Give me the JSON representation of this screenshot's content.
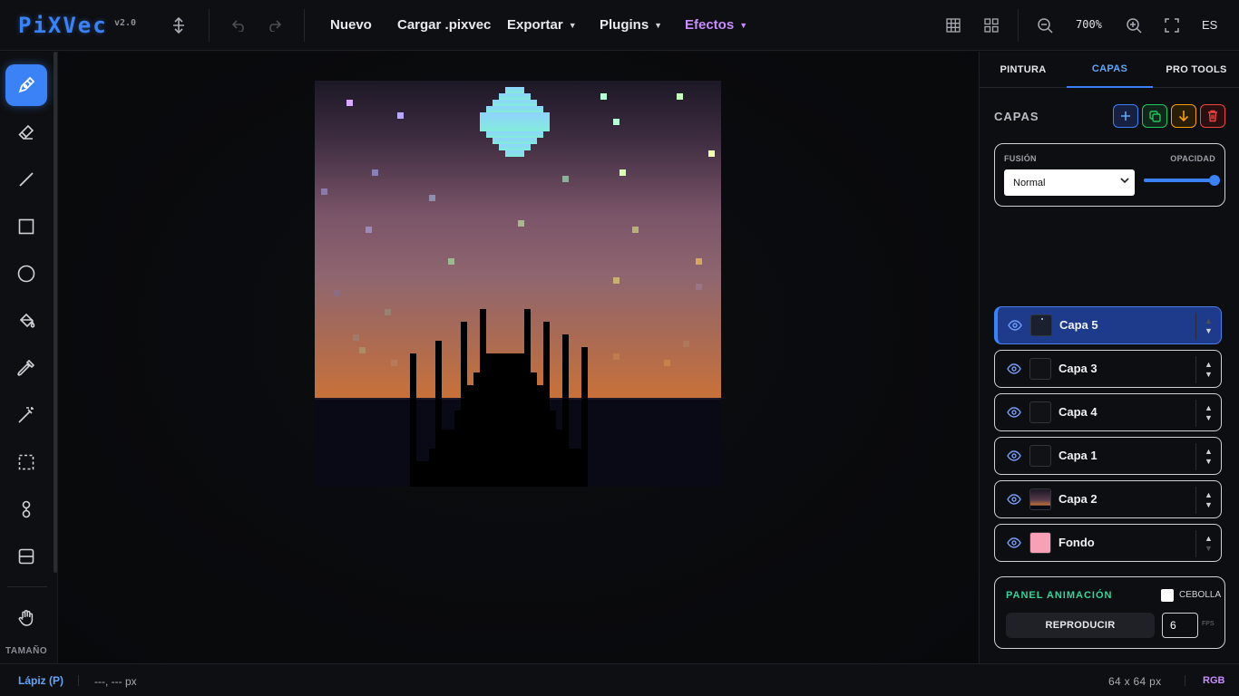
{
  "app": {
    "logo": "PiXVec",
    "version": "v2.0"
  },
  "topbar": {
    "menu": [
      {
        "label": "Nuevo",
        "caret": false
      },
      {
        "label": "Cargar .pixvec",
        "caret": false
      },
      {
        "label": "Exportar",
        "caret": true
      },
      {
        "label": "Plugins",
        "caret": true
      },
      {
        "label": "Efectos",
        "caret": true,
        "accent": "#c98cff"
      }
    ],
    "zoom": "700%",
    "language": "ES",
    "icons": [
      "pivot-icon",
      "undo-icon",
      "redo-icon",
      "grid-icon",
      "tiles-icon",
      "zoom-out-icon",
      "zoom-in-icon",
      "fullscreen-icon"
    ]
  },
  "toolbar": {
    "tools": [
      "pencil",
      "eraser",
      "line",
      "rectangle",
      "ellipse",
      "bucket-fill",
      "eyedropper",
      "magic-wand",
      "selection",
      "symmetry",
      "layer-split",
      "hand"
    ],
    "active_tool": "pencil",
    "size_label": "TAMAÑO"
  },
  "panel": {
    "tabs": [
      {
        "label": "PINTURA",
        "active": false
      },
      {
        "label": "CAPAS",
        "active": true
      },
      {
        "label": "PRO TOOLS",
        "active": false
      }
    ],
    "title": "CAPAS",
    "actions": [
      {
        "name": "add",
        "glyph": "+",
        "color": "#3b82f6"
      },
      {
        "name": "duplicate",
        "glyph": "⧉",
        "color": "#22c55e"
      },
      {
        "name": "merge-down",
        "glyph": "↓",
        "color": "#f59e0b"
      },
      {
        "name": "delete",
        "glyph": "🗑",
        "color": "#ef4444"
      }
    ],
    "blend": {
      "label": "FUSIÓN",
      "value": "Normal",
      "opacity_label": "OPACIDAD",
      "opacity": 1.0
    },
    "layers": [
      {
        "name": "Capa 5",
        "selected": true,
        "thumb": "dark-dot"
      },
      {
        "name": "Capa 3",
        "selected": false,
        "thumb": "dark"
      },
      {
        "name": "Capa 4",
        "selected": false,
        "thumb": "dark"
      },
      {
        "name": "Capa 1",
        "selected": false,
        "thumb": "dark"
      },
      {
        "name": "Capa 2",
        "selected": false,
        "thumb": "sunset"
      },
      {
        "name": "Fondo",
        "selected": false,
        "thumb": "pink"
      }
    ],
    "animation": {
      "title": "PANEL ANIMACIÓN",
      "onion_label": "CEBOLLA",
      "onion_checked": false,
      "play_label": "REPRODUCIR",
      "fps": "6",
      "fps_label": "FPS"
    }
  },
  "status": {
    "tool": "Lápiz (P)",
    "coords": "---, --- px",
    "size": "64 x 64 px",
    "mode": "RGB"
  },
  "colors": {
    "accent": "#3b82f6",
    "effects": "#c98cff",
    "animation": "#34d399",
    "sky_top": "#1c1826",
    "sky_mid": "#8a5f73",
    "sky_low": "#c8713a",
    "water": "#0a0a16",
    "moon_top": "#8fd2ff",
    "moon_bottom": "#82ecda"
  }
}
